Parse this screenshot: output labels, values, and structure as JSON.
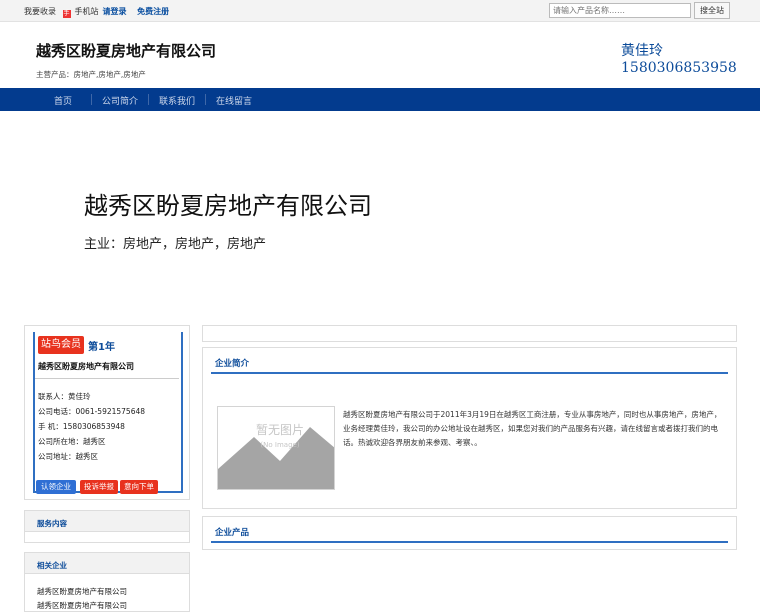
{
  "topbar": {
    "links": [
      "我要收录",
      "手机站",
      "请登录",
      "免费注册"
    ],
    "mobile_icon": "手",
    "search": {
      "placeholder": "请输入产品名称……",
      "button_label": "搜全站"
    }
  },
  "header": {
    "company_name": "越秀区盼夏房地产有限公司",
    "main_products": "主营产品：房地产,房地产,房地产",
    "contact_name": "黄佳玲",
    "contact_phone": "1580306853958"
  },
  "nav": {
    "items": [
      {
        "label": "首页"
      },
      {
        "label": "公司简介"
      },
      {
        "label": "联系我们"
      },
      {
        "label": "在线留言"
      }
    ]
  },
  "banner": {
    "title": "越秀区盼夏房地产有限公司",
    "subtitle": "主业：房地产，房地产，房地产"
  },
  "company_card": {
    "badge": "站鸟会员",
    "year": "第1年",
    "name": "越秀区盼夏房地产有限公司",
    "contact": "联系人：黄佳玲",
    "tel": "公司电话：0061-5921575648",
    "mobile": "手  机：1580306853948",
    "location": "公司所在地：越秀区",
    "address": "公司地址：越秀区",
    "buttons": [
      "认领企业",
      "投诉举报",
      "意向下单"
    ],
    "button_colors": [
      "#2f6fd4",
      "#e8321e",
      "#e8321e"
    ]
  },
  "sidebar": {
    "services_title": "服务内容",
    "related_title": "相关企业",
    "related_items": [
      "越秀区盼夏房地产有限公司",
      "越秀区盼夏房地产有限公司"
    ]
  },
  "main": {
    "intro_title": "企业简介",
    "intro_text": "越秀区盼夏房地产有限公司于2011年3月19日在越秀区工商注册，专业从事房地产，同时也从事房地产，房地产，业务经理黄佳玲，我公司的办公地址设在越秀区，如果您对我们的产品服务有兴趣，请在线留言或者拨打我们的电话。热诚欢迎各界朋友前来参观、考察、。",
    "no_image_cn": "暂无图片",
    "no_image_en": "(No Image)",
    "products_title": "企业产品"
  },
  "colors": {
    "nav_bg": "#033b8e",
    "accent_blue": "#0d4c9a",
    "badge_red": "#e8321e"
  }
}
